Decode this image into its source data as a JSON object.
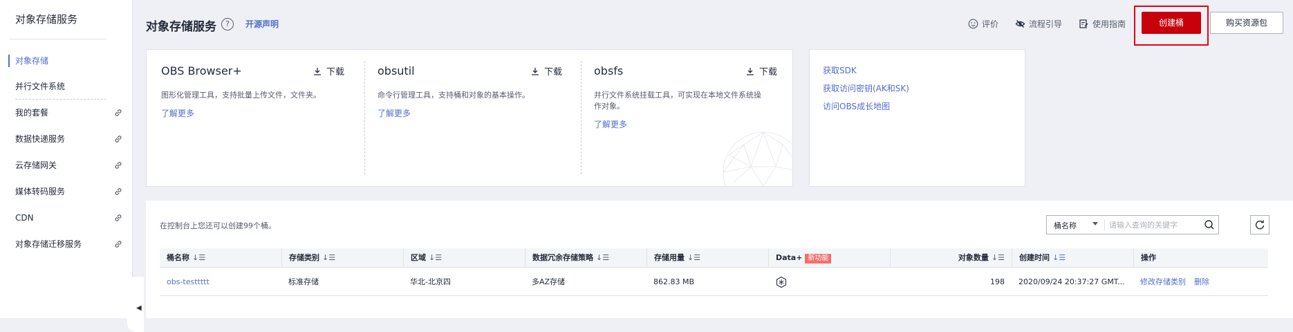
{
  "sidebar": {
    "title": "对象存储服务",
    "items": [
      {
        "label": "对象存储"
      },
      {
        "label": "并行文件系统"
      },
      {
        "label": "我的套餐"
      },
      {
        "label": "数据快递服务"
      },
      {
        "label": "云存储网关"
      },
      {
        "label": "媒体转码服务"
      },
      {
        "label": "CDN"
      },
      {
        "label": "对象存储迁移服务"
      }
    ]
  },
  "header": {
    "title": "对象存储服务",
    "help": "?",
    "open_source": "开源声明",
    "rate": "评价",
    "guide": "流程引导",
    "manual": "使用指南",
    "create_bucket": "创建桶",
    "buy_package": "购买资源包"
  },
  "tools": [
    {
      "name": "OBS Browser+",
      "download": "下载",
      "desc": "图形化管理工具，支持批量上传文件，文件夹。",
      "more": "了解更多"
    },
    {
      "name": "obsutil",
      "download": "下载",
      "desc": "命令行管理工具，支持桶和对象的基本操作。",
      "more": "了解更多"
    },
    {
      "name": "obsfs",
      "download": "下载",
      "desc_line1": "并行文件系统挂载工具，可实现在本地文件系统操",
      "desc_line2": "作对象。",
      "more": "了解更多"
    }
  ],
  "links": [
    "获取SDK",
    "获取访问密钥(AK和SK)",
    "访问OBS成长地图"
  ],
  "quota_text": "在控制台上您还可以创建99个桶。",
  "search": {
    "field": "桶名称",
    "placeholder": "请输入查询的关键字"
  },
  "table": {
    "columns": [
      "桶名称",
      "存储类别",
      "区域",
      "数据冗余存储策略",
      "存储用量",
      "Data+",
      "对象数量",
      "创建时间",
      "操作"
    ],
    "new_badge": "新功能",
    "sort_icon": "↓☰",
    "rows": [
      {
        "name": "obs-testtttt",
        "class": "标准存储",
        "region": "华北-北京四",
        "redundancy": "多AZ存储",
        "usage": "862.83 MB",
        "objects": "198",
        "created": "2020/09/24 20:37:27 GMT...",
        "op_modify": "修改存储类别",
        "op_delete": "删除"
      }
    ]
  },
  "colors": {
    "accent": "#526ecc",
    "brand_red": "#c7000b",
    "highlight_border": "#e60012"
  }
}
